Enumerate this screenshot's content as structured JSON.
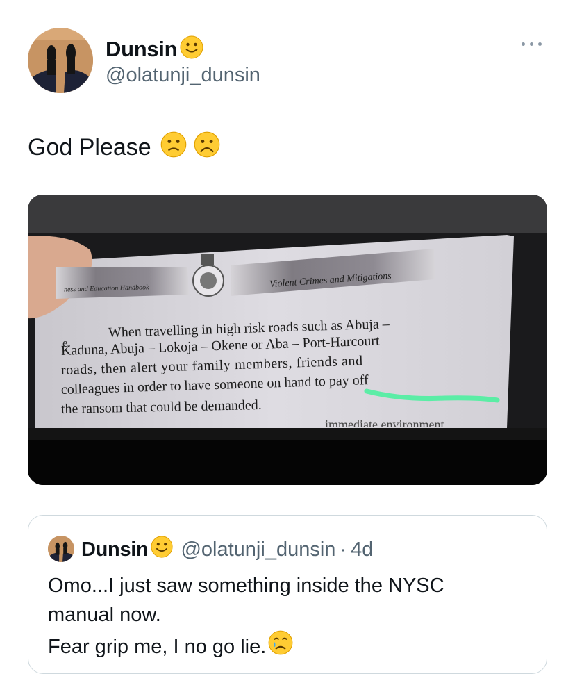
{
  "tweet": {
    "author_name": "Dunsin",
    "author_handle": "@olatunji_dunsin",
    "text": "God Please",
    "text_emojis": [
      "slightly-frowning-face",
      "frowning-face"
    ]
  },
  "media": {
    "book_header_left": "ness and Education Handbook",
    "book_header_right": "Violent Crimes and Mitigations",
    "item_marker": "e.",
    "lines": [
      "When travelling in high risk roads such as Abuja –",
      "Kaduna, Abuja – Lokoja – Okene or Aba – Port-Harcourt",
      "roads, then alert your family members, friends and",
      "colleagues in order to have someone on hand to pay off",
      "the ransom that could be demanded."
    ],
    "cut_line": "immediate environment",
    "highlight_color": "#4ef0a0"
  },
  "quote": {
    "author_name": "Dunsin",
    "author_handle": "@olatunji_dunsin",
    "separator": "·",
    "age": "4d",
    "lines": [
      "Omo...I just saw something inside the NYSC",
      "manual now.",
      "Fear grip me, I no go lie."
    ],
    "end_emoji": "crying-face"
  },
  "colors": {
    "text_primary": "#0f1419",
    "text_secondary": "#536471",
    "border": "#cfd9de",
    "emoji_yellow": "#ffcc33"
  }
}
